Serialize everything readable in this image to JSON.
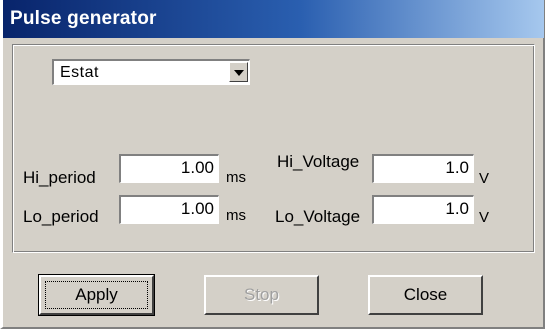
{
  "window": {
    "title": "Pulse generator"
  },
  "mode": {
    "selected": "Estat"
  },
  "fields": {
    "hi_period": {
      "label": "Hi_period",
      "value": "1.00",
      "unit": "ms"
    },
    "lo_period": {
      "label": "Lo_period",
      "value": "1.00",
      "unit": "ms"
    },
    "hi_voltage": {
      "label": "Hi_Voltage",
      "value": "1.0",
      "unit": "V"
    },
    "lo_voltage": {
      "label": "Lo_Voltage",
      "value": "1.0",
      "unit": "V"
    }
  },
  "buttons": {
    "apply": "Apply",
    "stop": "Stop",
    "close": "Close"
  },
  "colors": {
    "title_bar_start": "#08246b",
    "title_bar_end": "#a6c8ee",
    "face": "#d4d0c8",
    "disabled_text": "#a0a0a0"
  }
}
